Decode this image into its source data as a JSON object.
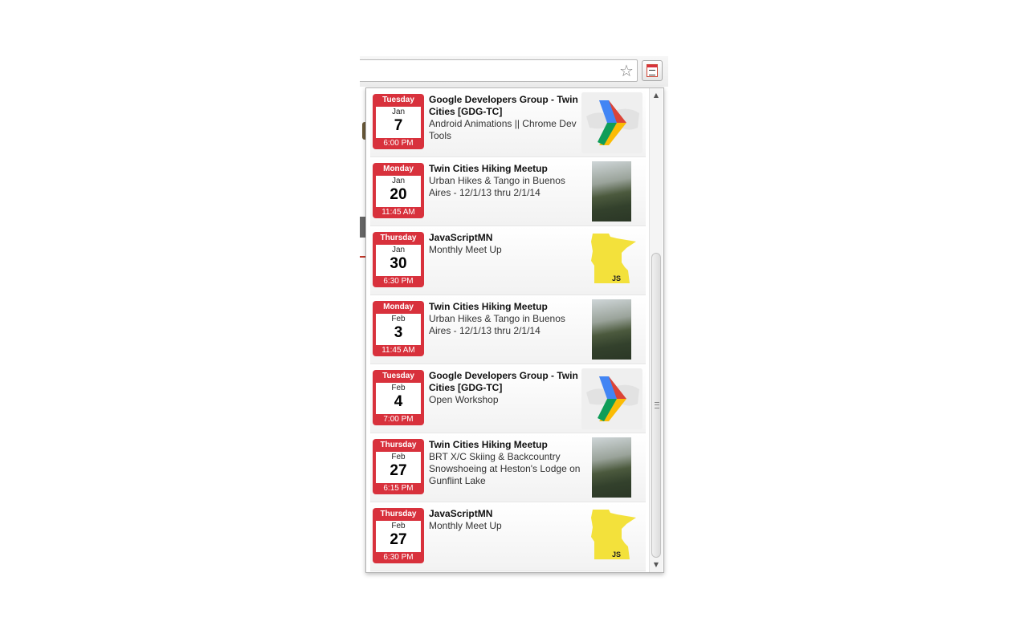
{
  "toolbar": {
    "bookmark_icon": "star-outline-icon",
    "extension_icon": "meetup-calendar-icon"
  },
  "events": [
    {
      "weekday": "Tuesday",
      "month": "Jan",
      "day": "7",
      "time": "6:00 PM",
      "group": "Google Developers Group - Twin Cities [GDG-TC]",
      "title": "Android Animations || Chrome Dev Tools",
      "thumb": "gdg"
    },
    {
      "weekday": "Monday",
      "month": "Jan",
      "day": "20",
      "time": "11:45 AM",
      "group": "Twin Cities Hiking Meetup",
      "title": "Urban Hikes & Tango in Buenos Aires - 12/1/13 thru 2/1/14",
      "thumb": "photo"
    },
    {
      "weekday": "Thursday",
      "month": "Jan",
      "day": "30",
      "time": "6:30 PM",
      "group": "JavaScriptMN",
      "title": "Monthly Meet Up",
      "thumb": "mn"
    },
    {
      "weekday": "Monday",
      "month": "Feb",
      "day": "3",
      "time": "11:45 AM",
      "group": "Twin Cities Hiking Meetup",
      "title": "Urban Hikes & Tango in Buenos Aires - 12/1/13 thru 2/1/14",
      "thumb": "photo"
    },
    {
      "weekday": "Tuesday",
      "month": "Feb",
      "day": "4",
      "time": "7:00 PM",
      "group": "Google Developers Group - Twin Cities [GDG-TC]",
      "title": "Open Workshop",
      "thumb": "gdg"
    },
    {
      "weekday": "Thursday",
      "month": "Feb",
      "day": "27",
      "time": "6:15 PM",
      "group": "Twin Cities Hiking Meetup",
      "title": "BRT X/C Skiing & Backcountry Snowshoeing at Heston's Lodge on Gunflint Lake",
      "thumb": "photo"
    },
    {
      "weekday": "Thursday",
      "month": "Feb",
      "day": "27",
      "time": "6:30 PM",
      "group": "JavaScriptMN",
      "title": "Monthly Meet Up",
      "thumb": "mn"
    }
  ],
  "mn_logo_text": "JS",
  "colors": {
    "accent": "#d8313c"
  }
}
